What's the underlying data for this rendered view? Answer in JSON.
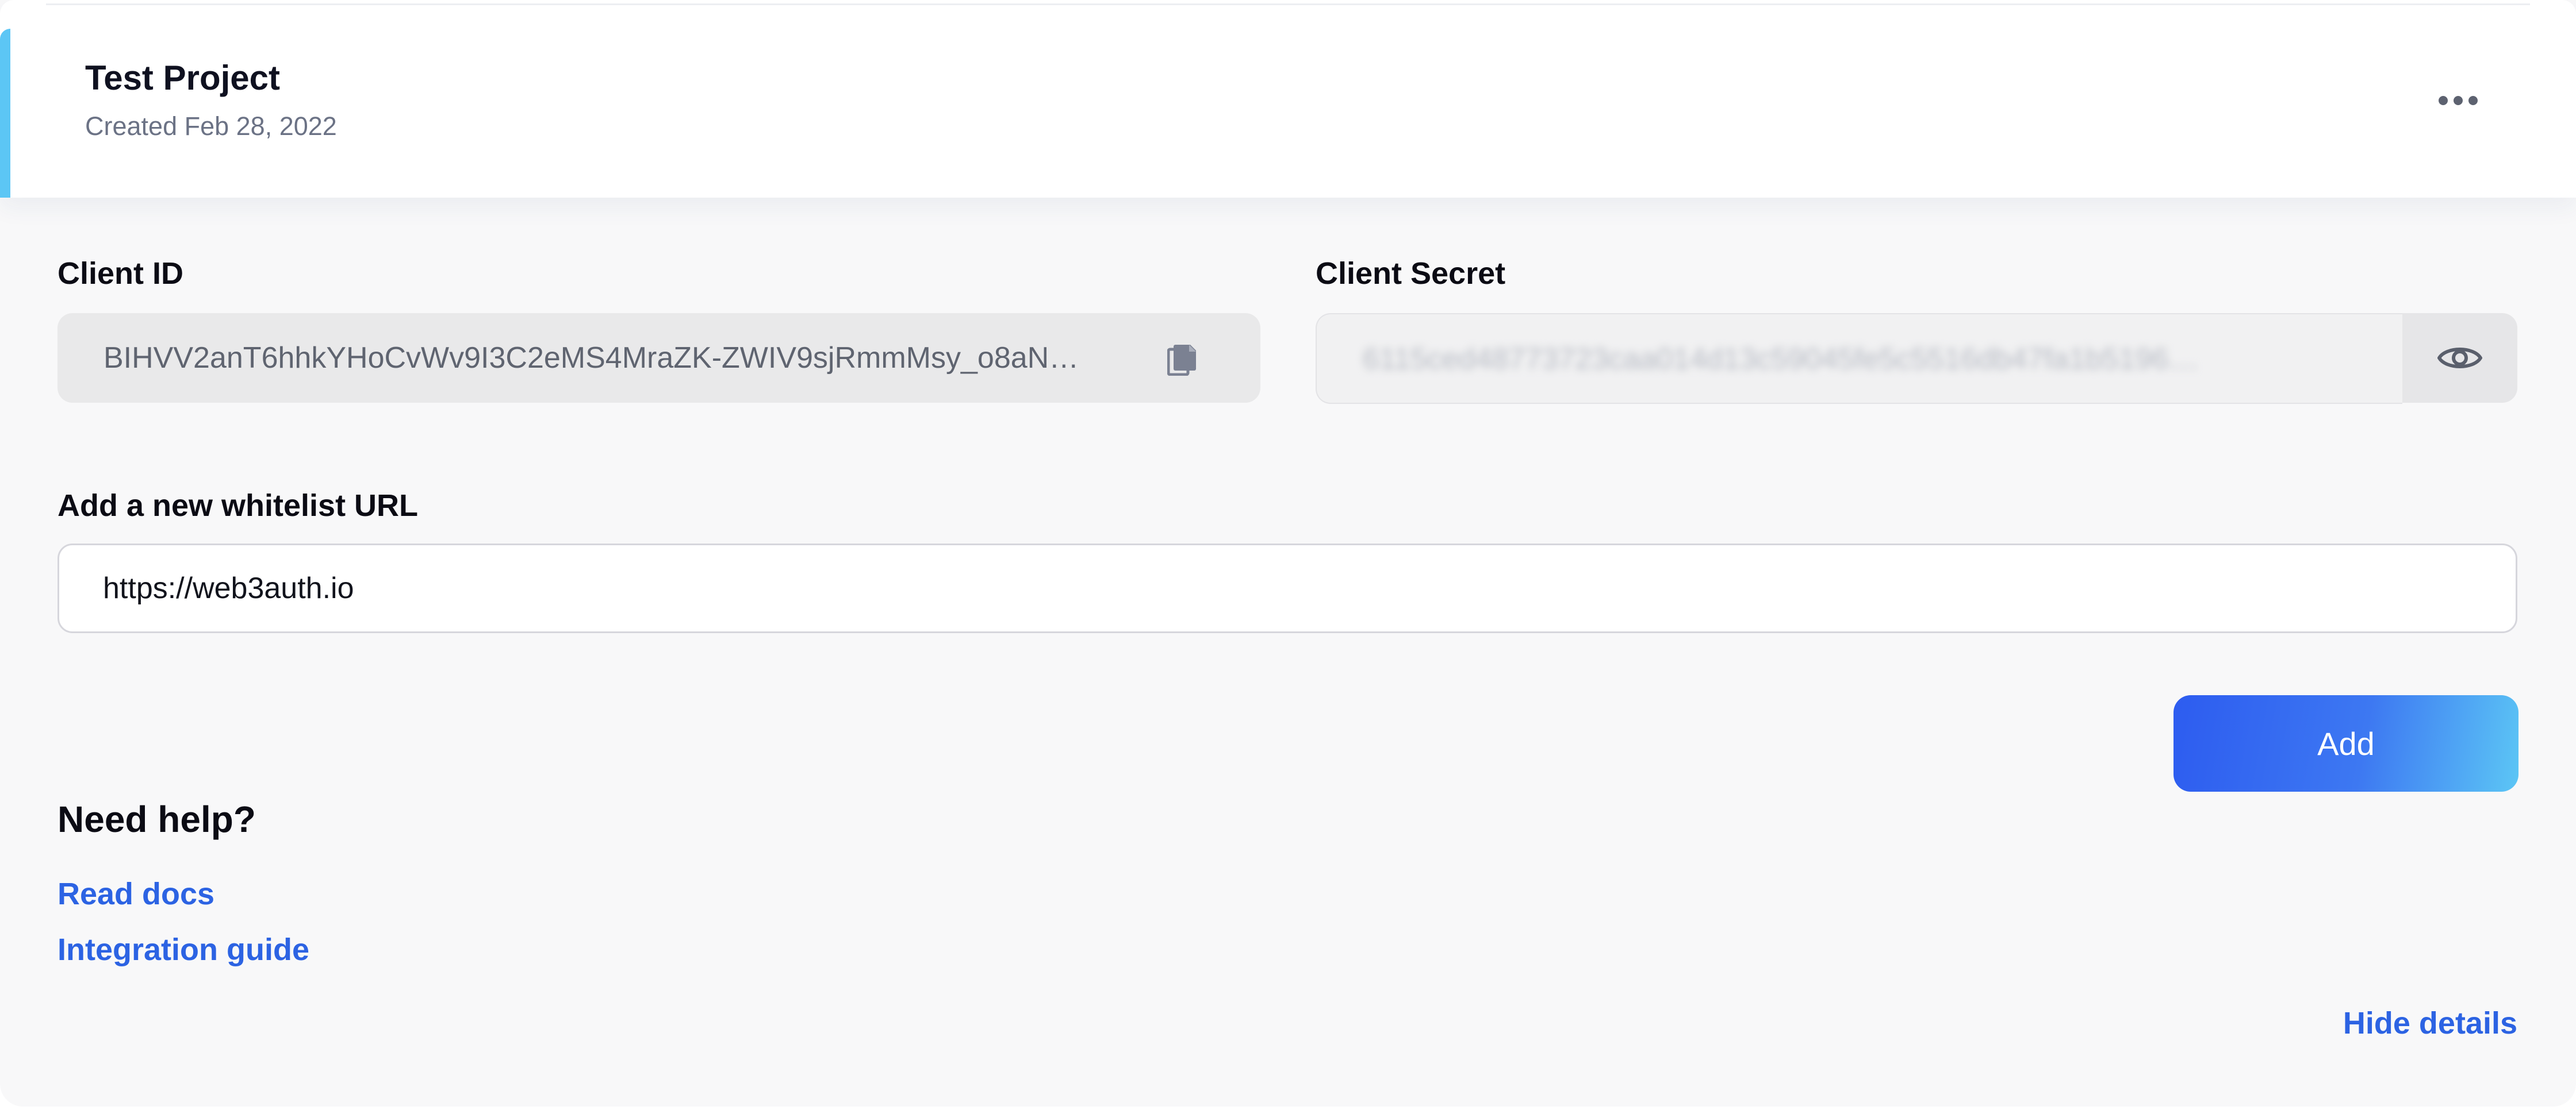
{
  "project": {
    "title": "Test Project",
    "created": "Created Feb 28, 2022",
    "accent_color": "#5cc6f5"
  },
  "icons": {
    "more": "ellipsis-horizontal-icon",
    "copy": "copy-icon",
    "reveal": "eye-icon"
  },
  "client_id": {
    "label": "Client ID",
    "value": "BIHVV2anT6hhkYHoCvWv9I3C2eMS4MraZK-ZWIV9sjRmmMsy_o8aN…"
  },
  "client_secret": {
    "label": "Client Secret",
    "value": "6115ced48773723caa014d13c59045fe5c5516db47fa1b5196…"
  },
  "whitelist": {
    "label": "Add a new whitelist URL",
    "value": "https://web3auth.io",
    "add_label": "Add"
  },
  "help": {
    "heading": "Need help?",
    "read_docs": "Read docs",
    "integration_guide": "Integration guide"
  },
  "footer": {
    "hide_details": "Hide details"
  },
  "colors": {
    "link": "#2c63e3",
    "button_gradient_start": "#2d5cf0",
    "button_gradient_end": "#5cc6f5"
  }
}
